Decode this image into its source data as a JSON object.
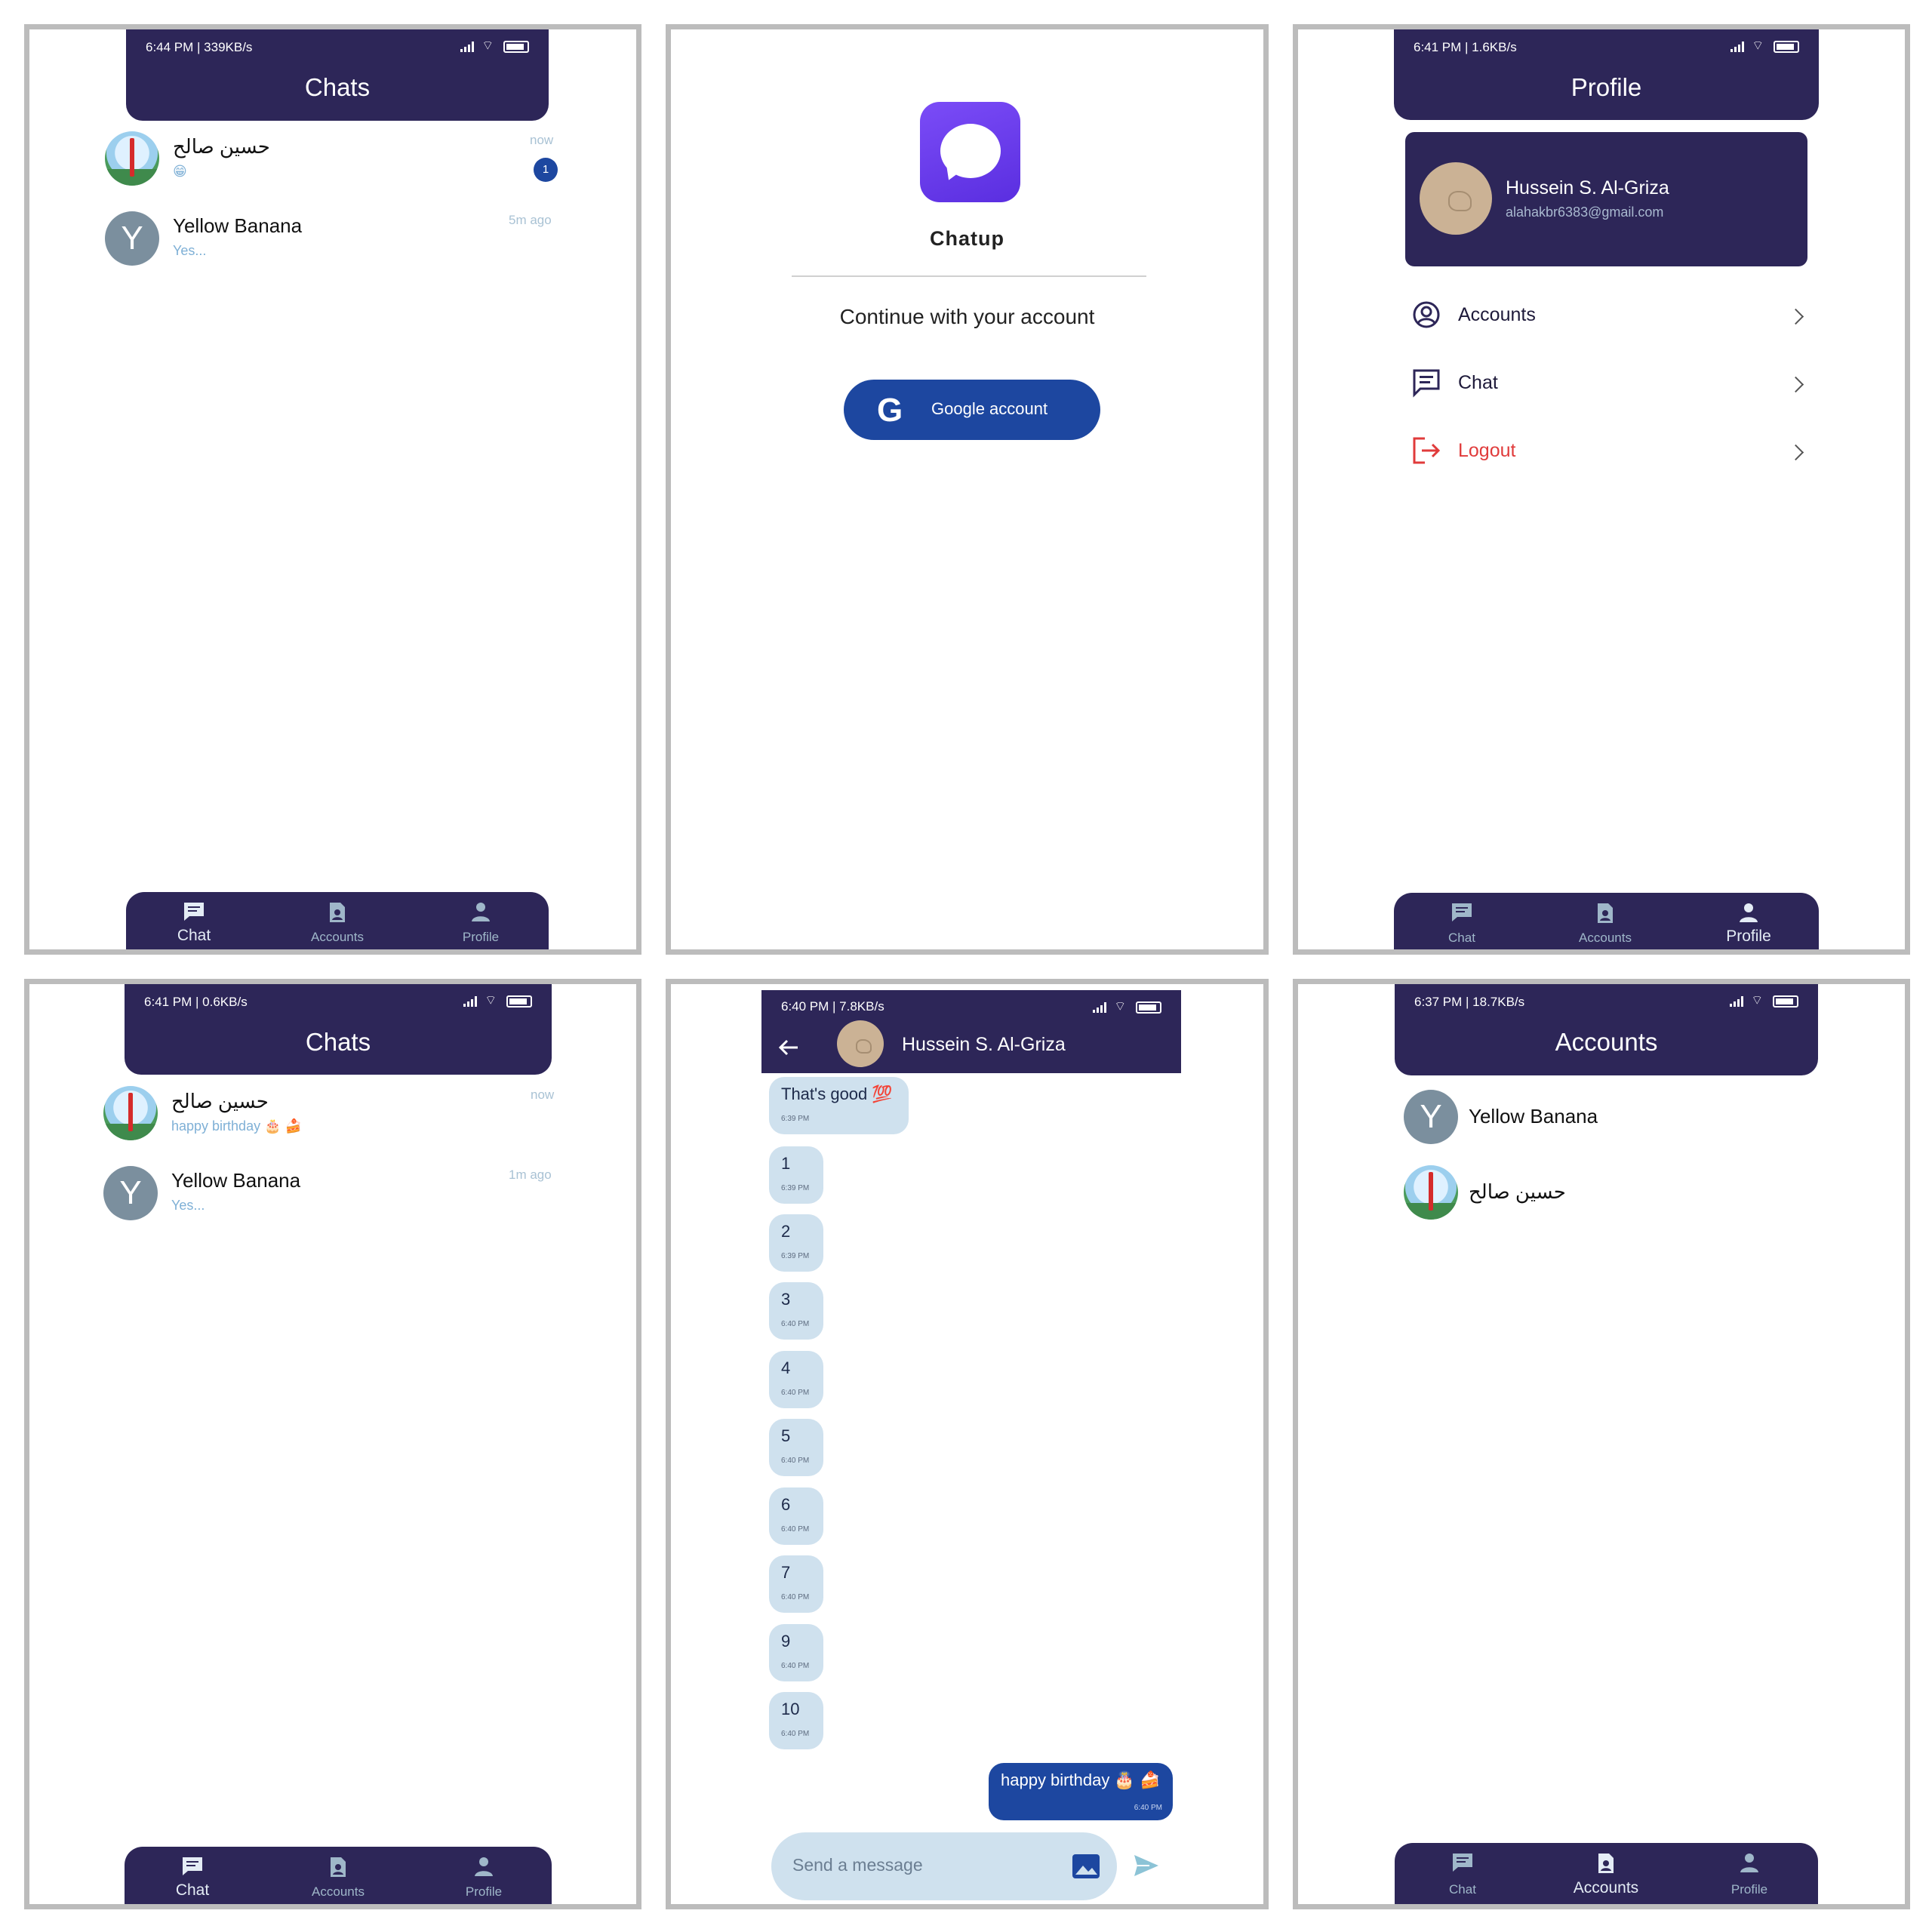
{
  "colors": {
    "header": "#2d2658",
    "accent_blue": "#1d47a0",
    "bubble": "#cfe1ee",
    "logout_red": "#e03b3b",
    "app_icon": "#6a3df0"
  },
  "panel1": {
    "status_time": "6:44 PM | 339KB/s",
    "title": "Chats",
    "chats": [
      {
        "name": "حسين صالح",
        "preview": "😁",
        "time": "now",
        "unread": "1"
      },
      {
        "name": "Yellow Banana",
        "initial": "Y",
        "preview": "Yes...",
        "time": "5m ago"
      }
    ]
  },
  "panel2": {
    "app_name": "Chatup",
    "subtitle": "Continue with your account",
    "google_button": "Google account",
    "google_glyph": "G"
  },
  "panel3": {
    "status_time": "6:41 PM | 1.6KB/s",
    "title": "Profile",
    "user_name": "Hussein S. Al-Griza",
    "user_email": "alahakbr6383@gmail.com",
    "menu": [
      {
        "label": "Accounts",
        "icon": "account-circle-icon"
      },
      {
        "label": "Chat",
        "icon": "chat-list-icon"
      },
      {
        "label": "Logout",
        "icon": "logout-icon"
      }
    ]
  },
  "panel4": {
    "status_time": "6:41 PM | 0.6KB/s",
    "title": "Chats",
    "chats": [
      {
        "name": "حسين صالح",
        "preview": "happy birthday 🎂 🍰",
        "time": "now"
      },
      {
        "name": "Yellow Banana",
        "initial": "Y",
        "preview": "Yes...",
        "time": "1m ago"
      }
    ]
  },
  "panel5": {
    "status_time": "6:40 PM | 7.8KB/s",
    "contact_name": "Hussein S. Al-Griza",
    "messages": [
      {
        "text": "That's good 💯",
        "time": "6:39 PM"
      },
      {
        "text": "1",
        "time": "6:39 PM"
      },
      {
        "text": "2",
        "time": "6:39 PM"
      },
      {
        "text": "3",
        "time": "6:40 PM"
      },
      {
        "text": "4",
        "time": "6:40 PM"
      },
      {
        "text": "5",
        "time": "6:40 PM"
      },
      {
        "text": "6",
        "time": "6:40 PM"
      },
      {
        "text": "7",
        "time": "6:40 PM"
      },
      {
        "text": "9",
        "time": "6:40 PM"
      },
      {
        "text": "10",
        "time": "6:40 PM"
      }
    ],
    "sent_message": {
      "text": "happy birthday 🎂 🍰",
      "time": "6:40 PM"
    },
    "input_placeholder": "Send a message"
  },
  "panel6": {
    "status_time": "6:37 PM | 18.7KB/s",
    "title": "Accounts",
    "accounts": [
      {
        "name": "Yellow Banana",
        "initial": "Y"
      },
      {
        "name": "حسين صالح"
      }
    ]
  },
  "nav": {
    "chat": "Chat",
    "accounts": "Accounts",
    "profile": "Profile"
  }
}
